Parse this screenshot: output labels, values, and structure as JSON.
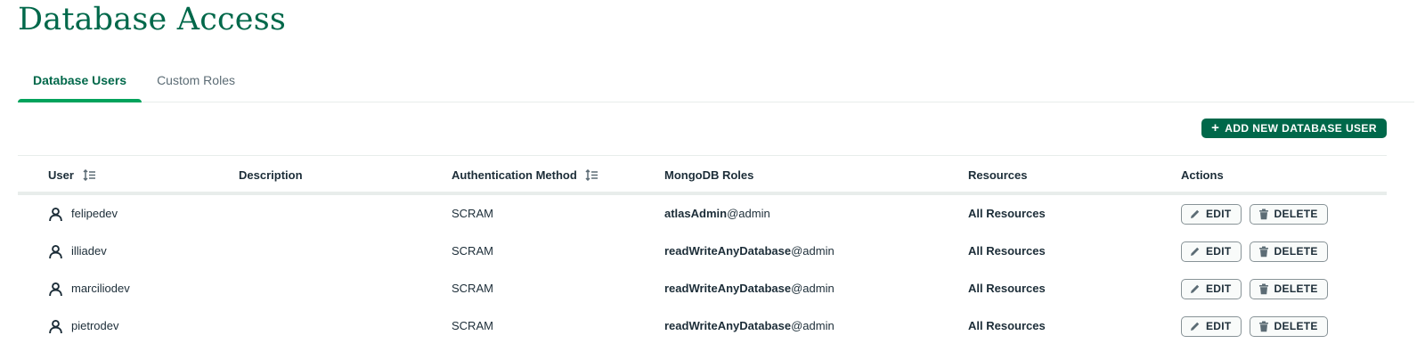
{
  "page": {
    "title": "Database Access"
  },
  "tabs": [
    {
      "label": "Database Users",
      "active": true
    },
    {
      "label": "Custom Roles",
      "active": false
    }
  ],
  "toolbar": {
    "add_button_label": "ADD NEW DATABASE USER",
    "add_button_icon": "plus-icon"
  },
  "table": {
    "headers": {
      "user": "User",
      "description": "Description",
      "auth_method": "Authentication Method",
      "roles": "MongoDB Roles",
      "resources": "Resources",
      "actions": "Actions"
    },
    "rows": [
      {
        "user": "felipedev",
        "description": "",
        "auth_method": "SCRAM",
        "role": "atlasAdmin",
        "role_db": "@admin",
        "resources": "All Resources"
      },
      {
        "user": "illiadev",
        "description": "",
        "auth_method": "SCRAM",
        "role": "readWriteAnyDatabase",
        "role_db": "@admin",
        "resources": "All Resources"
      },
      {
        "user": "marciliodev",
        "description": "",
        "auth_method": "SCRAM",
        "role": "readWriteAnyDatabase",
        "role_db": "@admin",
        "resources": "All Resources"
      },
      {
        "user": "pietrodev",
        "description": "",
        "auth_method": "SCRAM",
        "role": "readWriteAnyDatabase",
        "role_db": "@admin",
        "resources": "All Resources"
      }
    ],
    "actions": {
      "edit_label": "EDIT",
      "delete_label": "DELETE"
    }
  },
  "colors": {
    "brand_green": "#00684a",
    "accent_green": "#00a35c",
    "text_dark": "#1c2d38",
    "text_muted": "#5c6c75"
  }
}
